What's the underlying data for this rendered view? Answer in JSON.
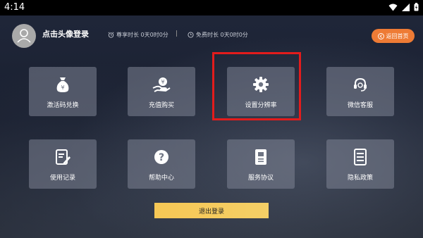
{
  "status_bar": {
    "time": "4:14"
  },
  "header": {
    "login_label": "点击头像登录",
    "vip_time": "尊享时长 0天0时0分",
    "free_time": "免费时长 0天0时0分",
    "home_button": "返回首页"
  },
  "tiles": [
    {
      "label": "激活码兑换",
      "icon": "money-bag-icon"
    },
    {
      "label": "充值购买",
      "icon": "hand-coin-icon"
    },
    {
      "label": "设置分辨率",
      "icon": "gear-icon"
    },
    {
      "label": "微信客服",
      "icon": "headset-icon"
    },
    {
      "label": "使用记录",
      "icon": "record-icon"
    },
    {
      "label": "帮助中心",
      "icon": "help-icon"
    },
    {
      "label": "服务协议",
      "icon": "document-icon"
    },
    {
      "label": "隐私政策",
      "icon": "policy-icon"
    }
  ],
  "logout_button": "退出登录",
  "colors": {
    "accent_orange": "#ee7b35",
    "logout_yellow": "#f6c755",
    "highlight_red": "#e31c1c"
  }
}
